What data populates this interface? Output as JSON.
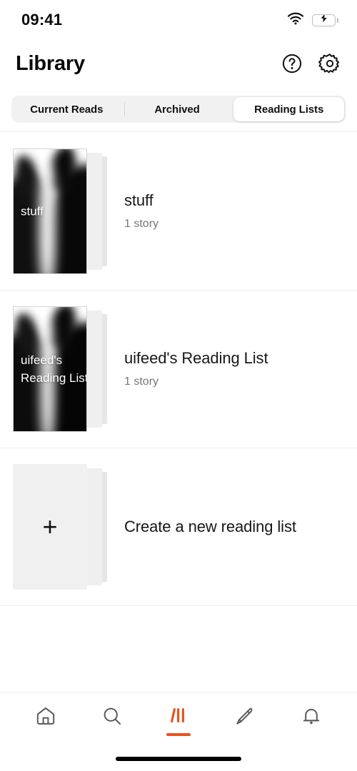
{
  "status_bar": {
    "time": "09:41",
    "wifi_icon": "wifi-icon",
    "battery_icon": "battery-charging-icon",
    "battery_color": "#32d74b"
  },
  "header": {
    "title": "Library",
    "help_icon": "help-circle-icon",
    "settings_icon": "gear-icon"
  },
  "tabs": {
    "items": [
      {
        "label": "Current Reads",
        "selected": false
      },
      {
        "label": "Archived",
        "selected": false
      },
      {
        "label": "Reading Lists",
        "selected": true
      }
    ]
  },
  "reading_lists": [
    {
      "title": "stuff",
      "subtitle": "1 story",
      "cover_label": "stuff",
      "cover_type": "image"
    },
    {
      "title": "uifeed's Reading List",
      "subtitle": "1 story",
      "cover_label": "uifeed's Reading List",
      "cover_type": "image"
    }
  ],
  "create_row": {
    "title": "Create a new reading list",
    "plus_glyph": "+",
    "cover_type": "placeholder"
  },
  "bottom_nav": {
    "active_color": "#E8521F",
    "inactive_color": "#5a5a5a",
    "items": [
      {
        "name": "home",
        "icon": "home-icon",
        "active": false
      },
      {
        "name": "search",
        "icon": "search-icon",
        "active": false
      },
      {
        "name": "library",
        "icon": "library-icon",
        "active": true
      },
      {
        "name": "write",
        "icon": "pencil-icon",
        "active": false
      },
      {
        "name": "notifications",
        "icon": "bell-icon",
        "active": false
      }
    ]
  }
}
